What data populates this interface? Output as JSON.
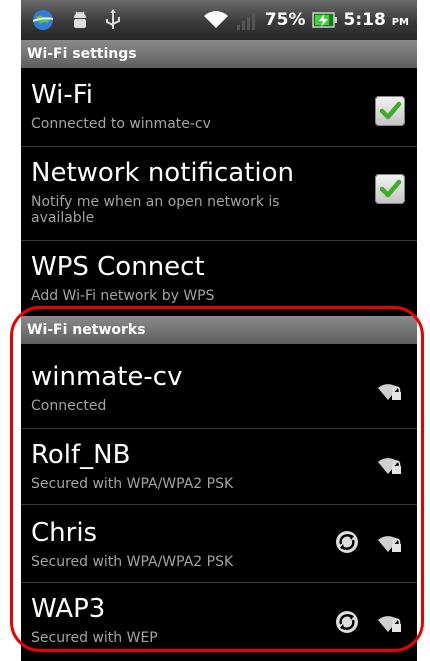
{
  "status_bar": {
    "battery_text": "75%",
    "clock_time": "5:18",
    "clock_ampm": "PM"
  },
  "settings_header": "Wi-Fi settings",
  "items": [
    {
      "title": "Wi-Fi",
      "subtitle": "Connected to winmate-cv",
      "checked": true
    },
    {
      "title": "Network notification",
      "subtitle": "Notify me when an open network is available",
      "checked": true
    },
    {
      "title": "WPS Connect",
      "subtitle": "Add Wi-Fi network by WPS"
    }
  ],
  "networks_header": "Wi-Fi networks",
  "networks": [
    {
      "ssid": "winmate-cv",
      "status": "Connected"
    },
    {
      "ssid": "Rolf_NB",
      "status": "Secured with WPA/WPA2 PSK"
    },
    {
      "ssid": "Chris",
      "status": "Secured with WPA/WPA2 PSK"
    },
    {
      "ssid": "WAP3",
      "status": "Secured with WEP"
    }
  ],
  "colors": {
    "highlight": "#ee0000",
    "checkmark": "#3fae2a"
  }
}
